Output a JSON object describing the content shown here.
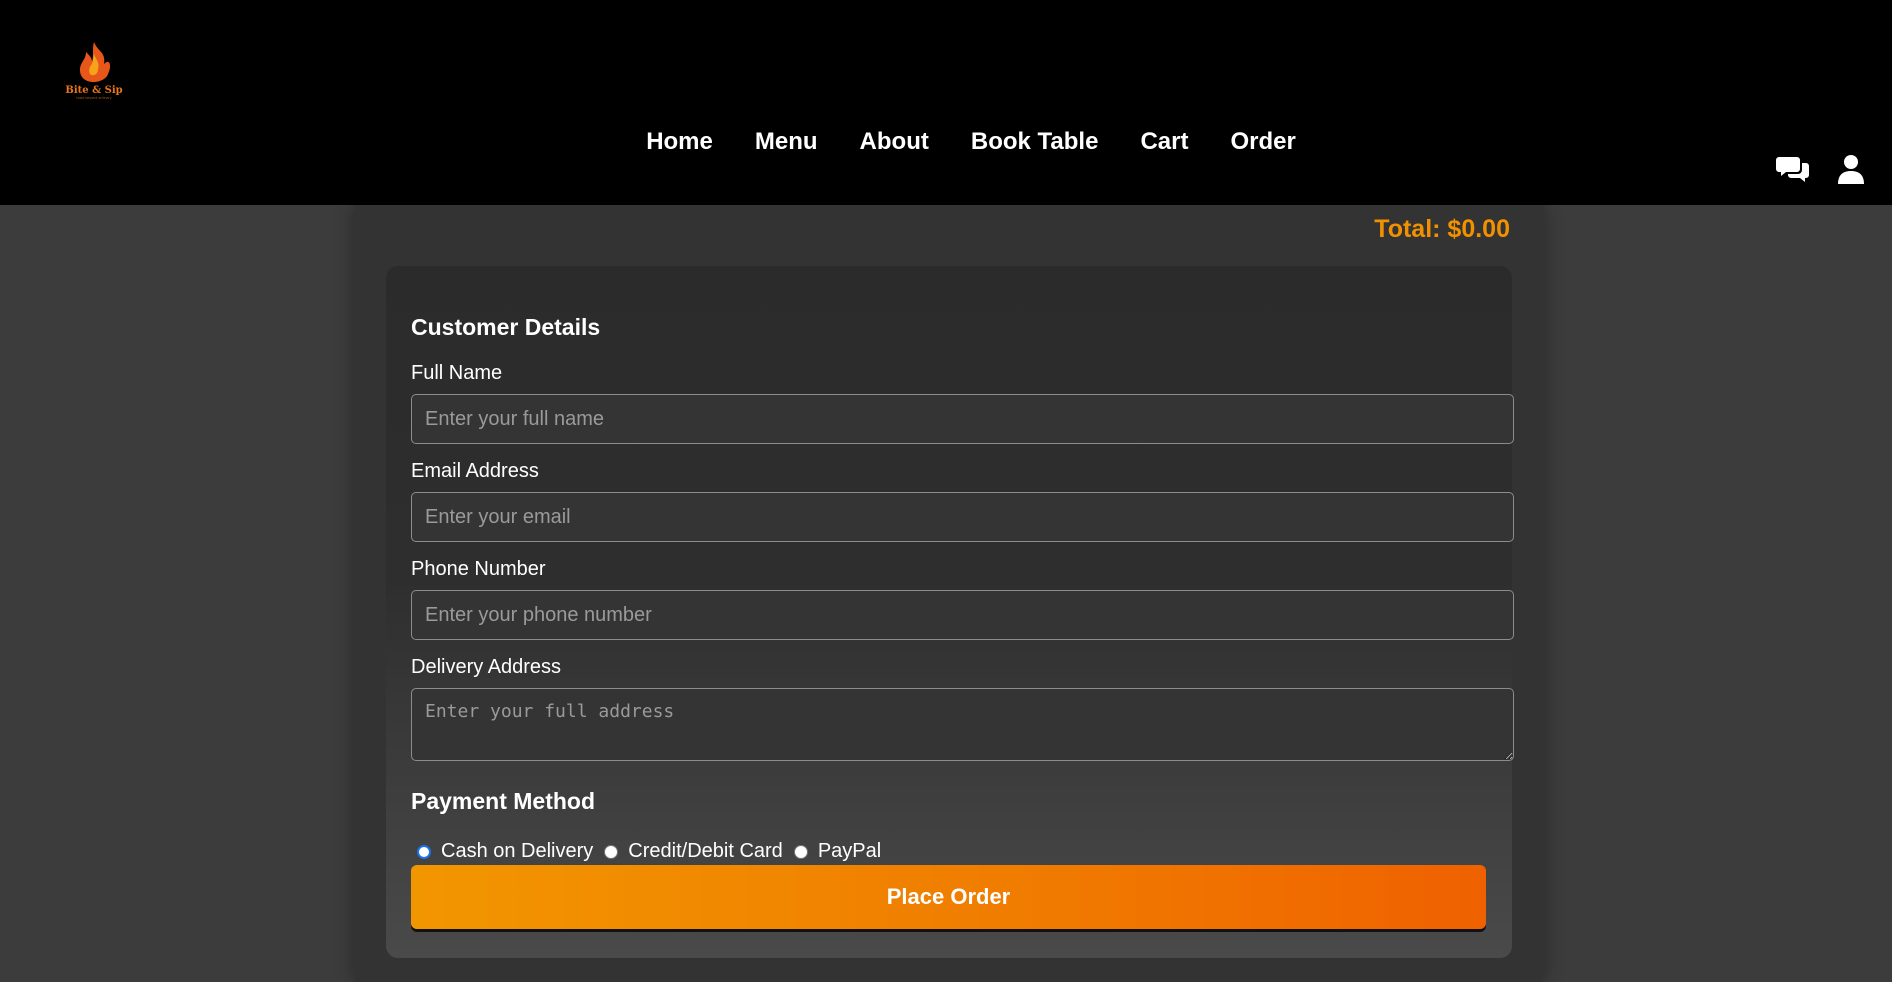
{
  "brand": {
    "logo_text": "Bite & Sip",
    "logo_tagline": "taste beyond ordinary",
    "accent_color": "#f29100"
  },
  "nav": {
    "items": [
      {
        "label": "Home"
      },
      {
        "label": "Menu"
      },
      {
        "label": "About"
      },
      {
        "label": "Book Table"
      },
      {
        "label": "Cart"
      },
      {
        "label": "Order"
      }
    ]
  },
  "header_icons": [
    "chat-icon",
    "user-icon"
  ],
  "order": {
    "total_label": "Total: $0.00"
  },
  "customer": {
    "title": "Customer Details",
    "fields": [
      {
        "label": "Full Name",
        "placeholder": "Enter your full name",
        "value": ""
      },
      {
        "label": "Email Address",
        "placeholder": "Enter your email",
        "value": ""
      },
      {
        "label": "Phone Number",
        "placeholder": "Enter your phone number",
        "value": ""
      },
      {
        "label": "Delivery Address",
        "placeholder": "Enter your full address",
        "value": ""
      }
    ]
  },
  "payment": {
    "title": "Payment Method",
    "options": [
      {
        "label": "Cash on Delivery",
        "selected": true
      },
      {
        "label": "Credit/Debit Card",
        "selected": false
      },
      {
        "label": "PayPal",
        "selected": false
      }
    ],
    "submit_label": "Place Order"
  }
}
